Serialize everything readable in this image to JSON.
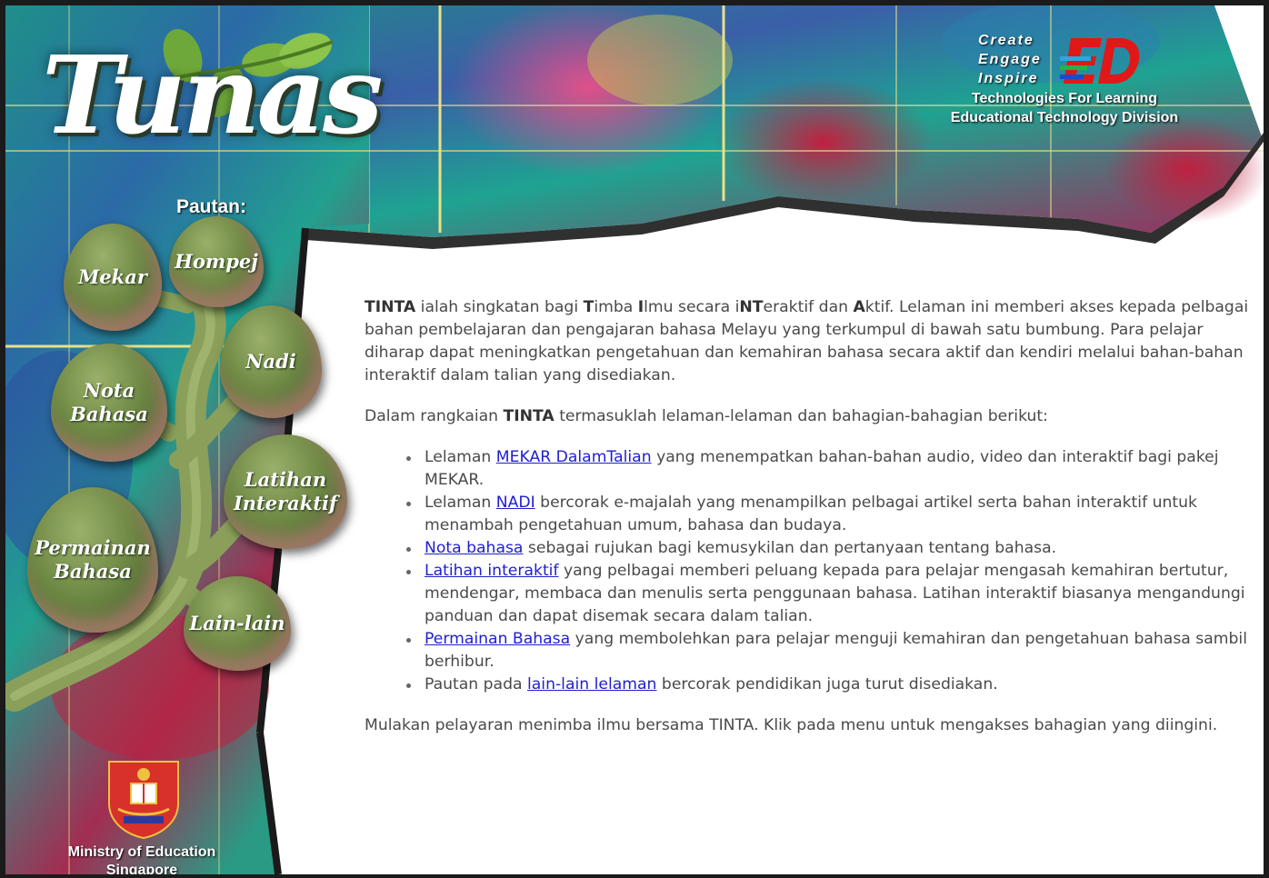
{
  "colors": {
    "link": "#1f1fd0",
    "body_text": "#4a4a4a",
    "page_bg": "#ffffff",
    "header_teal": "#22a393",
    "header_magenta": "#b0285e",
    "bud_green": "#6f8a45"
  },
  "logo": {
    "text": "Tunas"
  },
  "sidebar": {
    "heading": "Pautan:",
    "menu": [
      {
        "label": "Mekar",
        "icon": "flower-bud-icon"
      },
      {
        "label": "Hompej",
        "icon": "flower-bud-icon"
      },
      {
        "label": "Nadi",
        "icon": "flower-bud-icon"
      },
      {
        "label": "Nota\nBahasa",
        "icon": "flower-bud-icon"
      },
      {
        "label": "Latihan\nInteraktif",
        "icon": "flower-bud-icon"
      },
      {
        "label": "Permainan\nBahasa",
        "icon": "flower-bud-icon"
      },
      {
        "label": "Lain-lain",
        "icon": "flower-bud-icon"
      }
    ],
    "ministry": {
      "line1": "Ministry of Education",
      "line2": "Singapore",
      "icon": "crest-icon"
    }
  },
  "header": {
    "cei": [
      "Create",
      "Engage",
      "Inspire"
    ],
    "ed_logo_text": "ED",
    "tech_line1": "Technologies For Learning",
    "tech_line2": "Educational Technology Division"
  },
  "content": {
    "intro": {
      "b1": "TINTA",
      "t1": " ialah singkatan bagi ",
      "b2": "T",
      "t2": "imba ",
      "b3": "I",
      "t3": "lmu secara i",
      "b4": "NT",
      "t4": "eraktif dan ",
      "b5": "A",
      "t5": "ktif.  Lelaman ini memberi akses kepada pelbagai bahan pembelajaran dan pengajaran bahasa Melayu yang terkumpul di bawah satu bumbung.  Para pelajar diharap dapat meningkatkan pengetahuan dan kemahiran bahasa secara aktif dan kendiri melalui bahan-bahan interaktif dalam talian yang disediakan."
    },
    "series": {
      "t1": "Dalam rangkaian ",
      "b1": "TINTA",
      "t2": " termasuklah lelaman-lelaman dan bahagian-bahagian berikut:"
    },
    "list": [
      {
        "pre": "Lelaman ",
        "link": "MEKAR DalamTalian",
        "post": " yang menempatkan bahan-bahan audio, video dan interaktif bagi pakej MEKAR."
      },
      {
        "pre": "Lelaman ",
        "link": "NADI",
        "post": " bercorak e-majalah yang menampilkan pelbagai artikel serta bahan interaktif untuk menambah pengetahuan umum, bahasa dan budaya."
      },
      {
        "pre": "",
        "link": "Nota bahasa",
        "post": " sebagai rujukan bagi kemusykilan dan pertanyaan tentang bahasa."
      },
      {
        "pre": "",
        "link": "Latihan interaktif",
        "post": " yang pelbagai memberi peluang kepada para pelajar mengasah kemahiran bertutur, mendengar, membaca dan menulis serta penggunaan bahasa. Latihan interaktif biasanya mengandungi panduan dan dapat disemak secara dalam talian."
      },
      {
        "pre": "",
        "link": "Permainan Bahasa",
        "post": " yang membolehkan para pelajar menguji kemahiran dan pengetahuan bahasa sambil berhibur."
      },
      {
        "pre": "Pautan pada ",
        "link": "lain-lain lelaman",
        "post": " bercorak pendidikan juga turut disediakan."
      }
    ],
    "closing": "Mulakan pelayaran menimba ilmu bersama TINTA.  Klik pada menu untuk mengakses bahagian yang diingini."
  }
}
